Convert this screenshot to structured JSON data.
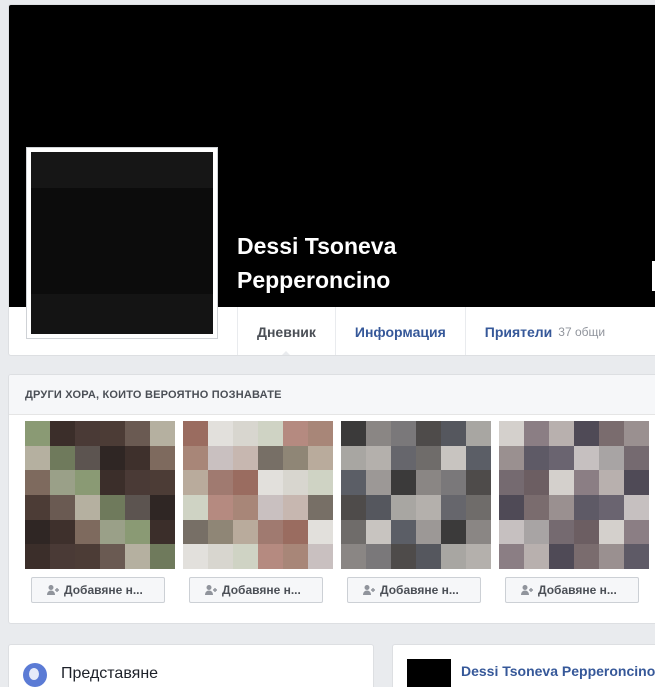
{
  "profile": {
    "name_line1": "Dessi Tsoneva",
    "name_line2": "Pepperoncino",
    "tabs": [
      {
        "label": "Дневник",
        "active": true
      },
      {
        "label": "Информация"
      },
      {
        "label": "Приятели",
        "count": "37 общи"
      }
    ]
  },
  "pymk": {
    "title": "ДРУГИ ХОРА, КОИТО ВЕРОЯТНО ПОЗНАВАТЕ",
    "people": [
      {
        "button": "Добавяне н..."
      },
      {
        "button": "Добавяне н..."
      },
      {
        "button": "Добавяне н..."
      },
      {
        "button": "Добавяне н..."
      }
    ],
    "icon": "add-friend-icon"
  },
  "intro": {
    "label": "Представяне",
    "icon": "globe-icon"
  },
  "post": {
    "author": "Dessi Tsoneva Pepperoncino"
  },
  "colors": {
    "link": "#365899",
    "background": "#e9ebee",
    "cover": "#000000"
  }
}
